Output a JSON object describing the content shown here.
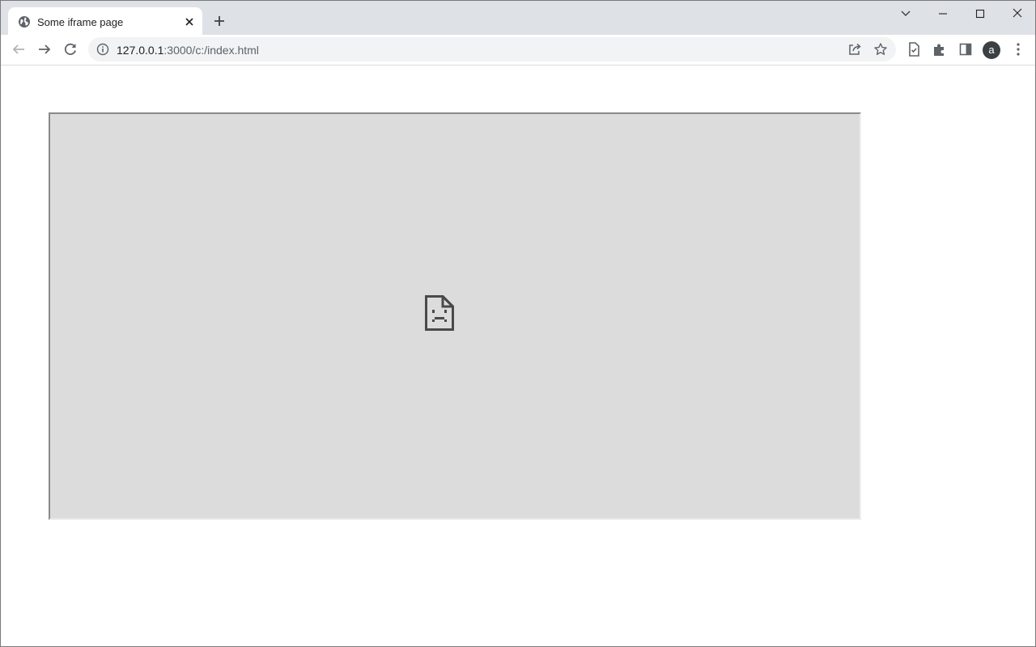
{
  "tab": {
    "title": "Some iframe page",
    "favicon": "globe-icon"
  },
  "toolbar": {
    "url_host": "127.0.0.1",
    "url_rest": ":3000/c:/index.html",
    "profile_initial": "a"
  },
  "iframe": {
    "state": "failed-to-load",
    "icon": "sad-document-icon",
    "background": "#dcdcdc"
  },
  "colors": {
    "tabstrip": "#dee1e6",
    "omnibox": "#f1f3f4",
    "icon": "#5f6368",
    "avatar": "#3c4043"
  }
}
